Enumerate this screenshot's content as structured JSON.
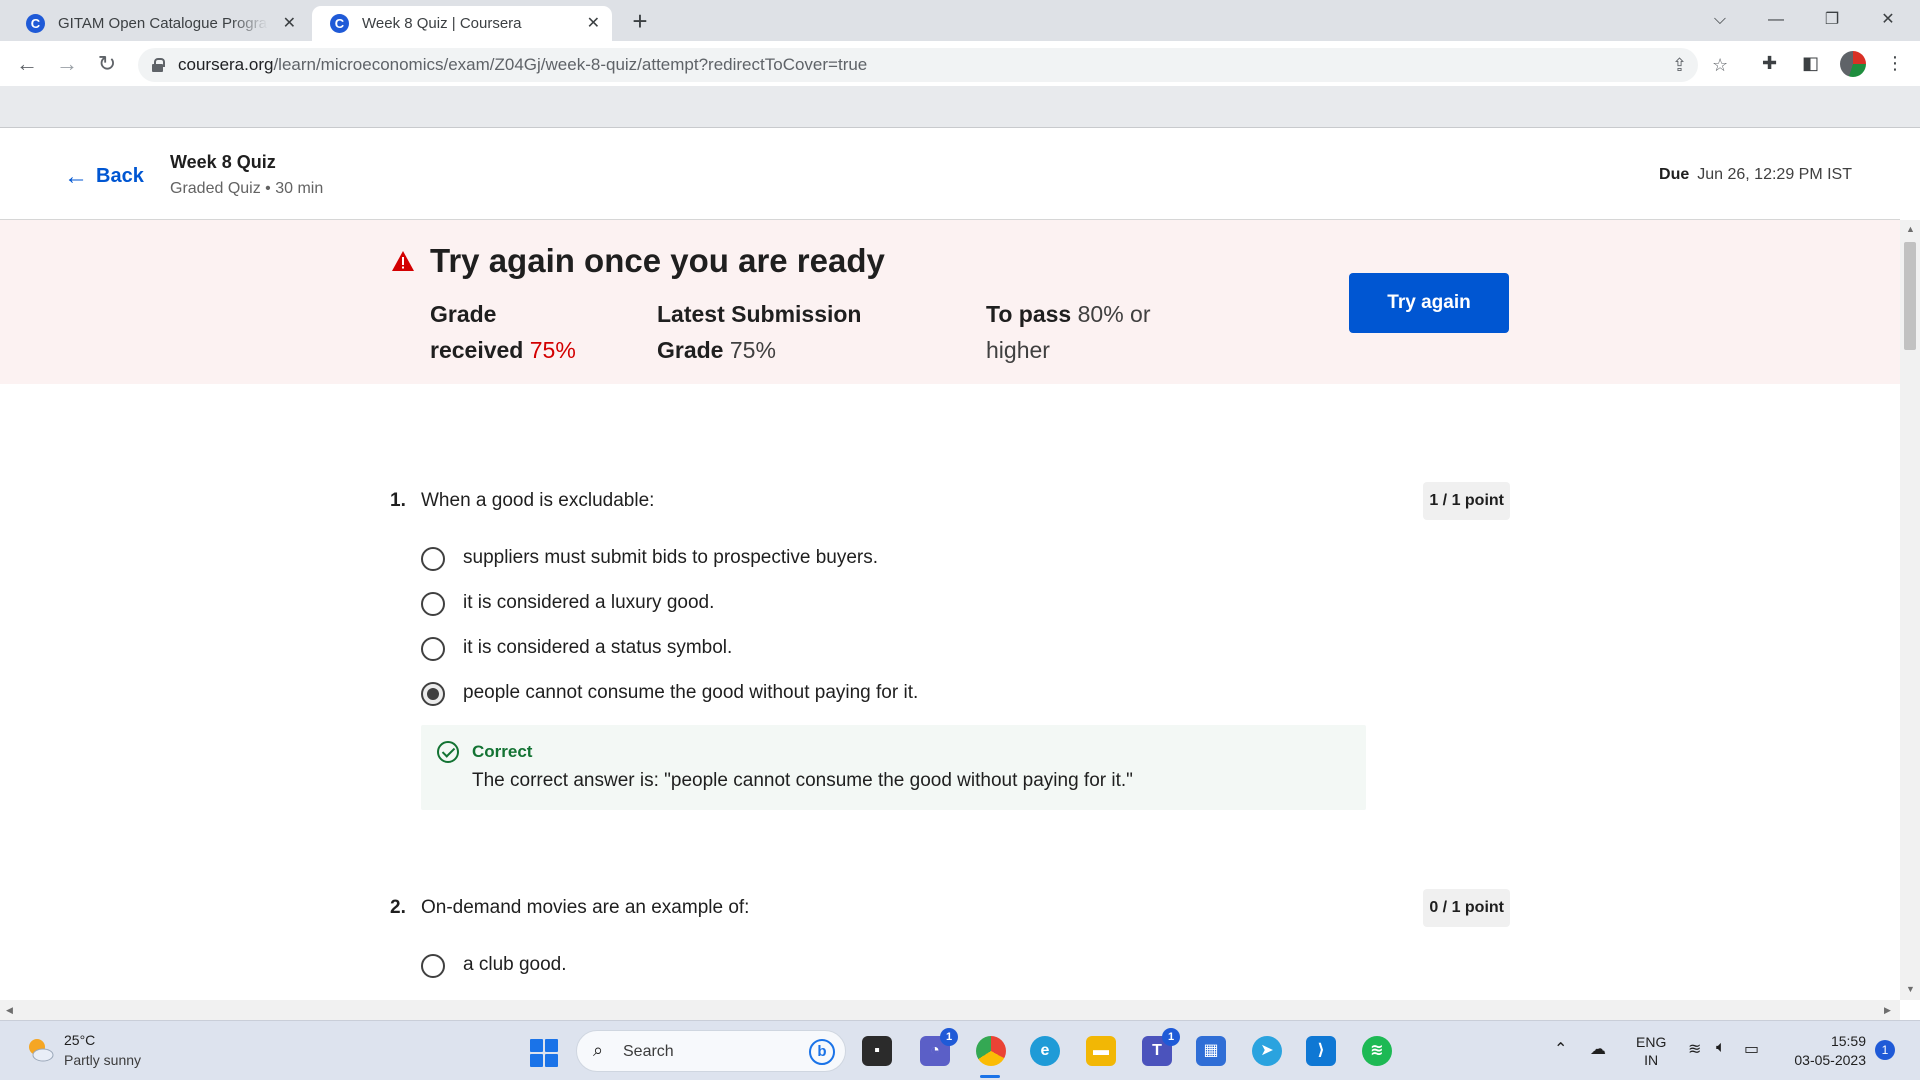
{
  "browser": {
    "tabs": [
      {
        "title": "GITAM Open Catalogue Program",
        "active": false
      },
      {
        "title": "Week 8 Quiz | Coursera",
        "active": true
      }
    ],
    "url_host": "coursera.org",
    "url_path": "/learn/microeconomics/exam/Z04Gj/week-8-quiz/attempt?redirectToCover=true",
    "favicon_letter": "C"
  },
  "header": {
    "back_label": "Back",
    "quiz_title": "Week 8 Quiz",
    "quiz_subtitle": "Graded Quiz • 30 min",
    "due_label": "Due",
    "due_value": "Jun 26, 12:29 PM IST"
  },
  "banner": {
    "title": "Try again once you are ready",
    "grade_received_label_1": "Grade",
    "grade_received_label_2": "received",
    "grade_received_value": "75%",
    "latest_label_1": "Latest Submission",
    "latest_label_2": "Grade",
    "latest_value": "75%",
    "pass_label": "To pass",
    "pass_value_1": "80% or",
    "pass_value_2": "higher",
    "try_again_label": "Try again"
  },
  "questions": [
    {
      "number": "1.",
      "text": "When a good is excludable:",
      "points": "1 / 1 point",
      "options": [
        "suppliers must submit bids to prospective buyers.",
        "it is considered a luxury good.",
        "it is considered a status symbol.",
        "people cannot consume the good without paying for it."
      ],
      "selected_option": 3,
      "feedback_title": "Correct",
      "feedback_text": "The correct answer is: \"people cannot consume the good without paying for it.\""
    },
    {
      "number": "2.",
      "text": "On-demand movies are an example of:",
      "points": "0 / 1 point",
      "options": [
        "a club good."
      ]
    }
  ],
  "taskbar": {
    "weather_temp": "25°C",
    "weather_desc": "Partly sunny",
    "search_label": "Search",
    "meet_badge": "1",
    "teams_badge": "1",
    "lang_1": "ENG",
    "lang_2": "IN",
    "time": "15:59",
    "date": "03-05-2023",
    "notification_count": "1"
  },
  "colors": {
    "primary": "#0056d2",
    "error": "#d30001",
    "success": "#137333",
    "banner_bg": "#fcf2f2"
  }
}
